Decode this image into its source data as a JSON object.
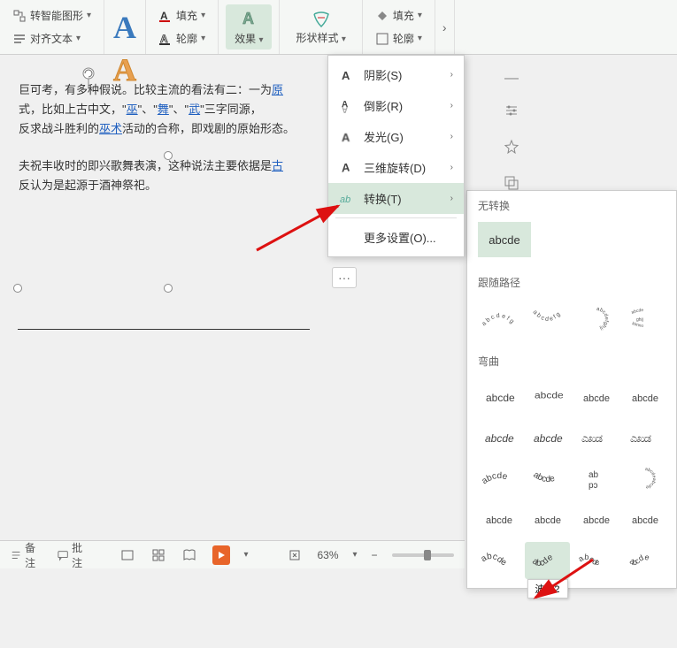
{
  "ribbon": {
    "group1": {
      "a": "□.",
      "b": "转智能图形",
      "c": "□.",
      "d": "对齐文本"
    },
    "fill_a": "填充",
    "outline_a": "轮廓",
    "effect": "效果",
    "shape_style": "形状样式",
    "fill_b": "填充",
    "outline_b": "轮廓"
  },
  "dropdown": {
    "shadow": "阴影(S)",
    "reflection": "倒影(R)",
    "glow": "发光(G)",
    "rotate3d": "三维旋转(D)",
    "transform": "转换(T)",
    "more": "更多设置(O)..."
  },
  "doc": {
    "p1a": "巨可考，有多种假说。比较主流的看法有二：一为",
    "p1link1": "原",
    "p1b": "式，比如上古中文，\"",
    "p1link2": "巫",
    "p1c": "\"、\"",
    "p1link3": "舞",
    "p1d": "\"、\"",
    "p1link4": "武",
    "p1e": "\"三字同源，",
    "p1f": "反求战斗胜利的",
    "p1link5": "巫术",
    "p1g": "活动的合称，即戏剧的原始形态。",
    "p2a": "夫祝丰收时的即兴歌舞表演，这种说法主要依据是",
    "p2link": "古",
    "p2b": "反认为是起源于酒神祭祀。"
  },
  "transform": {
    "none_header": "无转换",
    "none_label": "abcde",
    "follow_header": "跟随路径",
    "bend_header": "弯曲",
    "tooltip": "波形2"
  },
  "status": {
    "notes": "备注",
    "comments": "批注",
    "zoom": "63%"
  },
  "side": {
    "minus": "—"
  }
}
